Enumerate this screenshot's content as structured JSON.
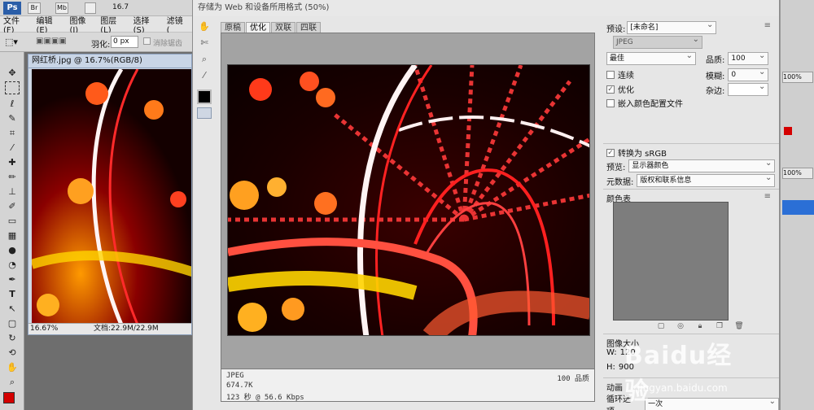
{
  "ps": {
    "logo": "Ps",
    "br_icon": "Br",
    "mb_icon": "Mb",
    "zoom_field": "16.7",
    "menu": [
      "文件(F)",
      "编辑(E)",
      "图像(I)",
      "图层(L)",
      "选择(S)",
      "滤镜("
    ],
    "options": {
      "feather_label": "羽化:",
      "feather_value": "0 px",
      "antialias_label": "消除锯齿"
    },
    "doc_tab": "网红桥.jpg @ 16.7%(RGB/8)",
    "doc_zoom": "16.67%",
    "doc_size": "文档:22.9M/22.9M"
  },
  "dialog": {
    "title": "存储为 Web 和设备所用格式 (50%)",
    "tabs": [
      "原稿",
      "优化",
      "双联",
      "四联"
    ],
    "active_tab": 1,
    "info": {
      "format": "JPEG",
      "size": "674.7K",
      "time": "123 秒 @ 56.6 Kbps",
      "quality": "100 品质"
    },
    "settings": {
      "preset_label": "预设:",
      "preset_value": "[未命名]",
      "format_value": "JPEG",
      "quality_preset": "最佳",
      "quality_label": "品质:",
      "quality_value": "100",
      "progressive_label": "连续",
      "blur_label": "模糊:",
      "blur_value": "0",
      "optimized_label": "优化",
      "matte_label": "杂边:",
      "embed_profile_label": "嵌入颜色配置文件",
      "convert_srgb_label": "转换为 sRGB",
      "preview_label": "预览:",
      "preview_value": "显示器颜色",
      "metadata_label": "元数据:",
      "metadata_value": "版权和联系信息",
      "color_table_label": "颜色表",
      "image_size_label": "图像大小",
      "width_label": "W:",
      "width_value": "120",
      "height_label": "H:",
      "height_value": "900",
      "animation_label": "动画",
      "loop_label": "循环选项:",
      "loop_value": "一次"
    },
    "checkboxes": {
      "progressive": false,
      "optimized": true,
      "embed_profile": false,
      "convert_srgb": true
    }
  },
  "watermark": {
    "main": "Baidu经验",
    "sub": "jingyan.baidu.com"
  },
  "icons": {
    "hand": "hand-icon",
    "slice_select": "slice-select-icon",
    "zoom": "zoom-icon",
    "eyedropper": "eyedropper-icon"
  },
  "colors": {
    "ps_blue": "#2b5ea8",
    "dialog_bg": "#e6e6e6",
    "preview_bg": "#a3a3a3",
    "color_table": "#7d7d7d"
  }
}
